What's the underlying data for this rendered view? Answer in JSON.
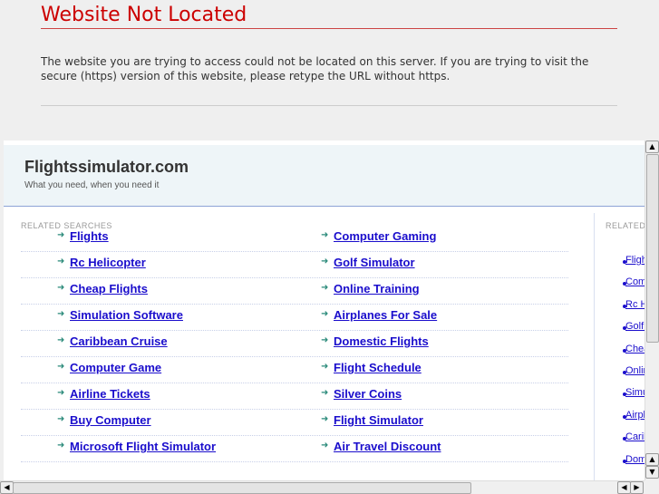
{
  "error": {
    "title": "Website Not Located",
    "message": "The website you are trying to access could not be located on this server. If you are trying to visit the secure (https) version of this website, please retype the URL without https."
  },
  "site": {
    "name": "Flightssimulator.com",
    "tagline": "What you need, when you need it"
  },
  "related_heading": "RELATED SEARCHES",
  "related_heading_right": "RELATED",
  "left_col": [
    "Flights",
    "Rc Helicopter",
    "Cheap Flights",
    "Simulation Software",
    "Caribbean Cruise",
    "Computer Game",
    "Airline Tickets",
    "Buy Computer",
    "Microsoft Flight Simulator"
  ],
  "right_col": [
    "Computer Gaming",
    "Golf Simulator",
    "Online Training",
    "Airplanes For Sale",
    "Domestic Flights",
    "Flight Schedule",
    "Silver Coins",
    "Flight Simulator",
    "Air Travel Discount"
  ],
  "sidebar": [
    "Flights",
    "Computer Gaming",
    "Rc Helicopter",
    "Golf Simulator",
    "Cheap Flights",
    "Online Training",
    "Simulation Software",
    "Airplanes For Sale",
    "Caribbean Cruise",
    "Domestic Flights"
  ]
}
